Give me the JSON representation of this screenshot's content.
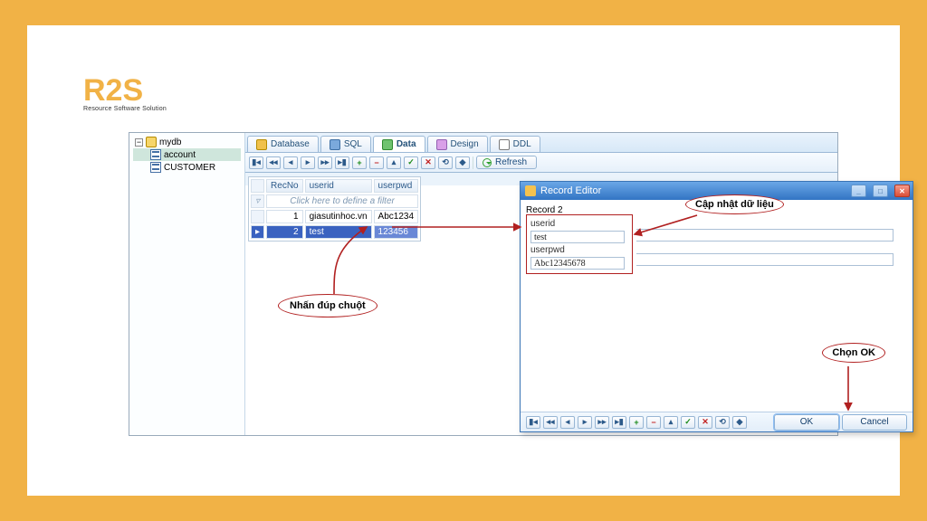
{
  "logo": {
    "title": "R2S",
    "subtitle": "Resource Software Solution"
  },
  "tree": {
    "db": "mydb",
    "items": [
      "account",
      "CUSTOMER"
    ]
  },
  "tabs": {
    "database": "Database",
    "sql": "SQL",
    "data": "Data",
    "design": "Design",
    "ddl": "DDL"
  },
  "toolbar": {
    "refresh": "Refresh"
  },
  "grid": {
    "cols": {
      "recno": "RecNo",
      "userid": "userid",
      "userpwd": "userpwd"
    },
    "filter": "Click here to define a filter",
    "rows": [
      {
        "recno": "1",
        "userid": "giasutinhoc.vn",
        "userpwd": "Abc1234"
      },
      {
        "recno": "2",
        "userid": "test",
        "userpwd": "123456"
      }
    ]
  },
  "dialog": {
    "title": "Record Editor",
    "recordLabel": "Record 2",
    "fields": {
      "userid_label": "userid",
      "userid_value": "test",
      "userpwd_label": "userpwd",
      "userpwd_value": "Abc12345678"
    },
    "ok": "OK",
    "cancel": "Cancel"
  },
  "annotations": {
    "doubleclick": "Nhấn đúp chuột",
    "update": "Cập nhật dữ liệu",
    "chooseOk": "Chọn OK"
  }
}
